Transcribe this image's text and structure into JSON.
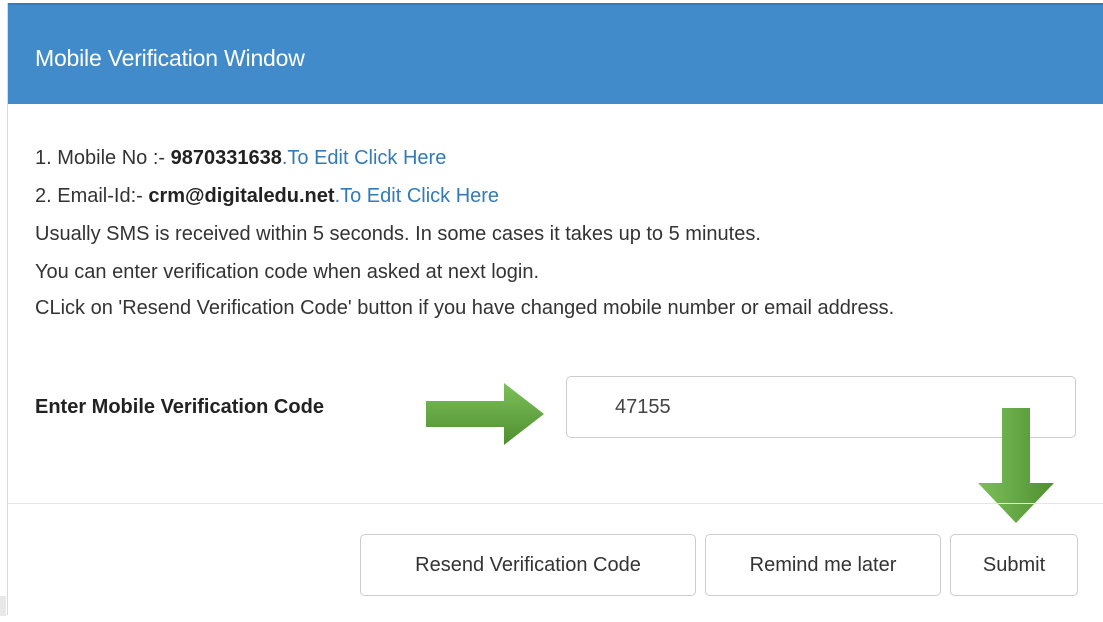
{
  "window": {
    "title": "Mobile Verification Window"
  },
  "info": {
    "mobile_prefix": "1. Mobile No :- ",
    "mobile_number": "9870331638",
    "mobile_edit_link": ".To Edit Click Here",
    "email_prefix": "2. Email-Id:- ",
    "email_value": "crm@digitaledu.net",
    "email_edit_link": ".To Edit Click Here",
    "sms_note": "Usually SMS is received within 5 seconds. In some cases it takes up to 5 minutes.",
    "login_note": "You can enter verification code when asked at next login.",
    "resend_note": "CLick on 'Resend Verification Code' button if you have changed mobile number or email address."
  },
  "verification": {
    "label": "Enter Mobile Verification Code",
    "code_value": "47155"
  },
  "buttons": {
    "resend": "Resend Verification Code",
    "remind": "Remind me later",
    "submit": "Submit"
  },
  "colors": {
    "header": "#428bca",
    "link": "#337ab7",
    "arrow": "#6aa84f"
  },
  "icons": {
    "right_arrow": "green-arrow-right-icon",
    "down_arrow": "green-arrow-down-icon"
  }
}
